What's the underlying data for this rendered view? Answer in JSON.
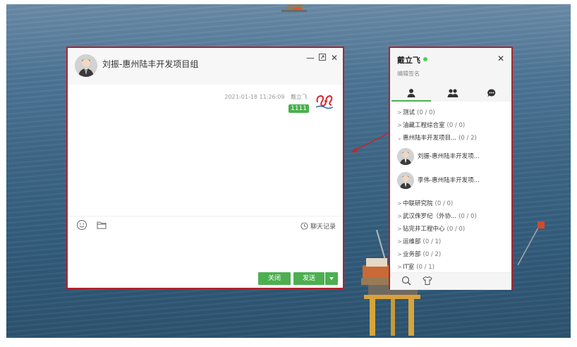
{
  "chat": {
    "title": "刘振-惠州陆丰开发项目组",
    "message": {
      "timestamp": "2021-01-18 11:26:09",
      "sender": "戴立飞",
      "text": "1111"
    },
    "history_label": "聊天记录",
    "close_label": "关闭",
    "send_label": "发送"
  },
  "panel": {
    "user_name": "戴立飞",
    "status_color": "#4cce55",
    "signature": "编辑签名",
    "groups_top": [
      {
        "name": "测试",
        "count": "(0 / 0)"
      },
      {
        "name": "油藏工程综合室",
        "count": "(0 / 0)"
      },
      {
        "name": "惠州陆丰开发项目...",
        "count": "(0 / 2)"
      }
    ],
    "members": [
      {
        "name": "刘振-惠州陆丰开发项..."
      },
      {
        "name": "李伟-惠州陆丰开发项..."
      }
    ],
    "groups_bottom": [
      {
        "name": "中联研究院",
        "count": "(0 / 0)"
      },
      {
        "name": "武汉侏罗纪（外协...",
        "count": "(0 / 0)"
      },
      {
        "name": "钻完井工程中心",
        "count": "(0 / 0)"
      },
      {
        "name": "运维部",
        "count": "(0 / 1)"
      },
      {
        "name": "业务部",
        "count": "(0 / 2)"
      },
      {
        "name": "IT室",
        "count": "(0 / 1)"
      }
    ]
  },
  "colors": {
    "accent_green": "#4caf50",
    "highlight_border": "#b3222c"
  }
}
